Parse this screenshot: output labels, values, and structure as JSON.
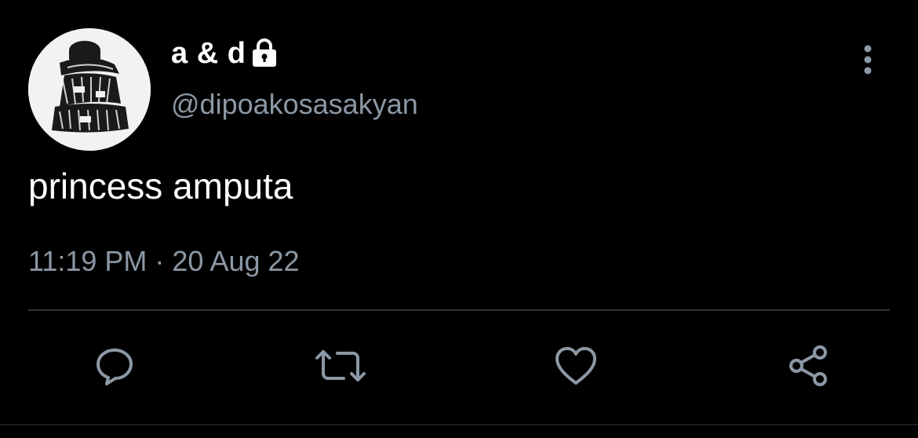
{
  "tweet": {
    "display_name": "a & d",
    "handle": "@dipoakosasakyan",
    "text": "princess amputa",
    "timestamp": "11:19 PM · 20 Aug 22"
  },
  "icons": {
    "lock": "lock-icon",
    "more": "more-vertical-icon",
    "reply": "reply-icon",
    "retweet": "retweet-icon",
    "like": "heart-icon",
    "share": "share-icon"
  },
  "colors": {
    "background": "#000000",
    "primary_text": "#ffffff",
    "secondary_text": "#8b98a5",
    "divider": "#2f3336",
    "icon": "#8b98a5"
  }
}
